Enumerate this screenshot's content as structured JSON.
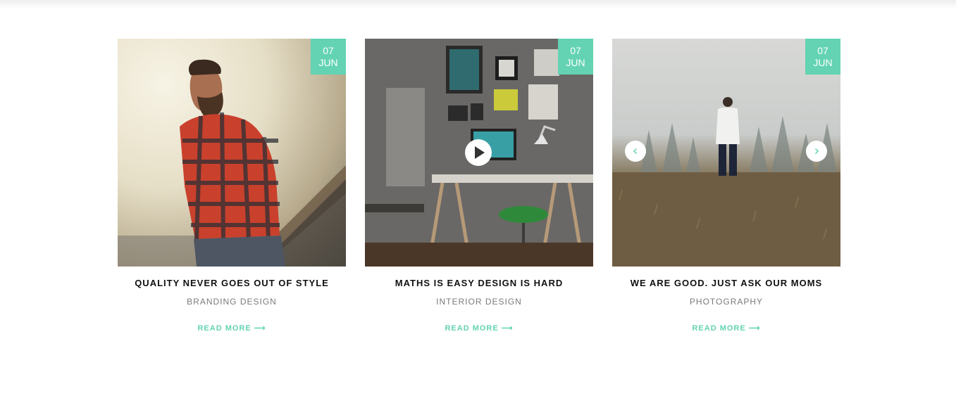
{
  "colors": {
    "accent": "#64d3b3",
    "title": "#111111",
    "category": "#7a7a7a"
  },
  "posts": [
    {
      "date": {
        "day": "07",
        "month": "JUN"
      },
      "title": "QUALITY NEVER GOES OUT OF STYLE",
      "category": "BRANDING DESIGN",
      "read_more": "READ MORE ⟶",
      "image": "man-in-red-plaid-shirt-photo"
    },
    {
      "date": {
        "day": "07",
        "month": "JUN"
      },
      "title": "MATHS IS EASY DESIGN IS HARD",
      "category": "INTERIOR DESIGN",
      "read_more": "READ MORE ⟶",
      "image": "interior-workspace-video-thumbnail",
      "overlay_icon": "play-icon"
    },
    {
      "date": {
        "day": "07",
        "month": "JUN"
      },
      "title": "WE ARE GOOD. JUST ASK OUR MOMS",
      "category": "PHOTOGRAPHY",
      "read_more": "READ MORE ⟶",
      "image": "man-in-foggy-field-photo",
      "slider_icons": [
        "chevron-left-icon",
        "chevron-right-icon"
      ]
    }
  ]
}
